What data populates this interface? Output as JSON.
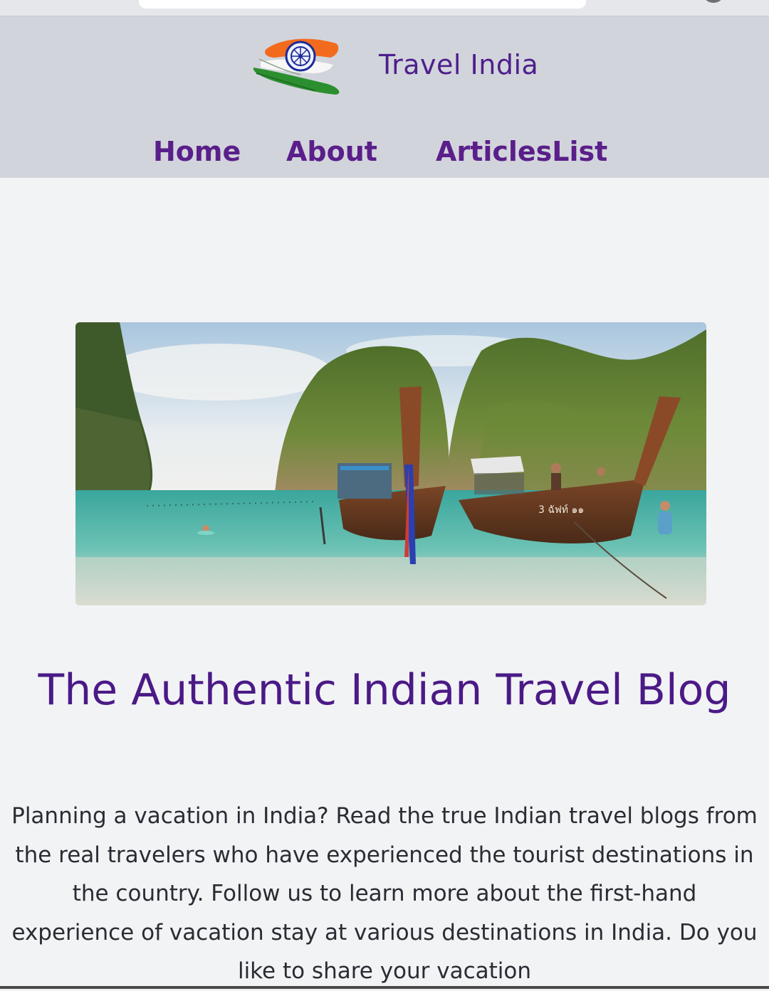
{
  "header": {
    "site_title": "Travel India",
    "logo_icon": "india-flag-emblem-icon"
  },
  "nav": {
    "items": [
      {
        "label": "Home"
      },
      {
        "label": "About"
      },
      {
        "label": "ArticlesList"
      }
    ]
  },
  "hero": {
    "image": "longtail-boats-beach-photo"
  },
  "main": {
    "heading": "The Authentic Indian Travel Blog",
    "intro": "Planning a vacation in India? Read the true Indian travel blogs from the real travelers who have experienced the tourist destinations in the country. Follow us to learn more about the first-hand experience of vacation stay at various destinations in India. Do you like to share your vacation"
  },
  "colors": {
    "header_bg": "#d2d4db",
    "page_bg": "#f2f3f5",
    "brand_purple": "#4b1a86"
  }
}
